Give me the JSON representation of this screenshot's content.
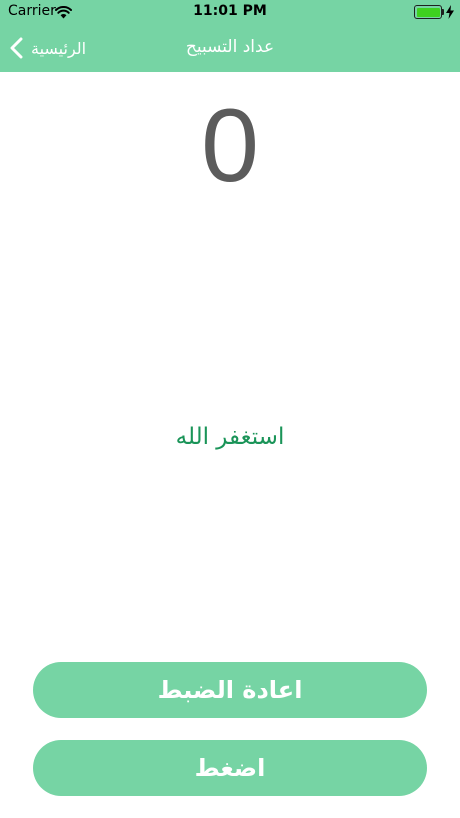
{
  "status_bar": {
    "carrier": "Carrier",
    "time": "11:01 PM",
    "battery_level": 1.0
  },
  "nav": {
    "back_label": "الرئيسية",
    "title": "عداد التسبيح"
  },
  "counter": {
    "value": "0"
  },
  "dhikr": {
    "text": "استغفر الله"
  },
  "buttons": {
    "reset_label": "اعادة الضبط",
    "press_label": "اضغط"
  },
  "colors": {
    "accent": "#76d4a4",
    "dhikr_text": "#1a9458",
    "counter_text": "#5c5c5c"
  },
  "icons": {
    "back": "chevron-left-icon",
    "wifi": "wifi-icon",
    "battery": "battery-icon",
    "charging": "bolt-icon"
  }
}
